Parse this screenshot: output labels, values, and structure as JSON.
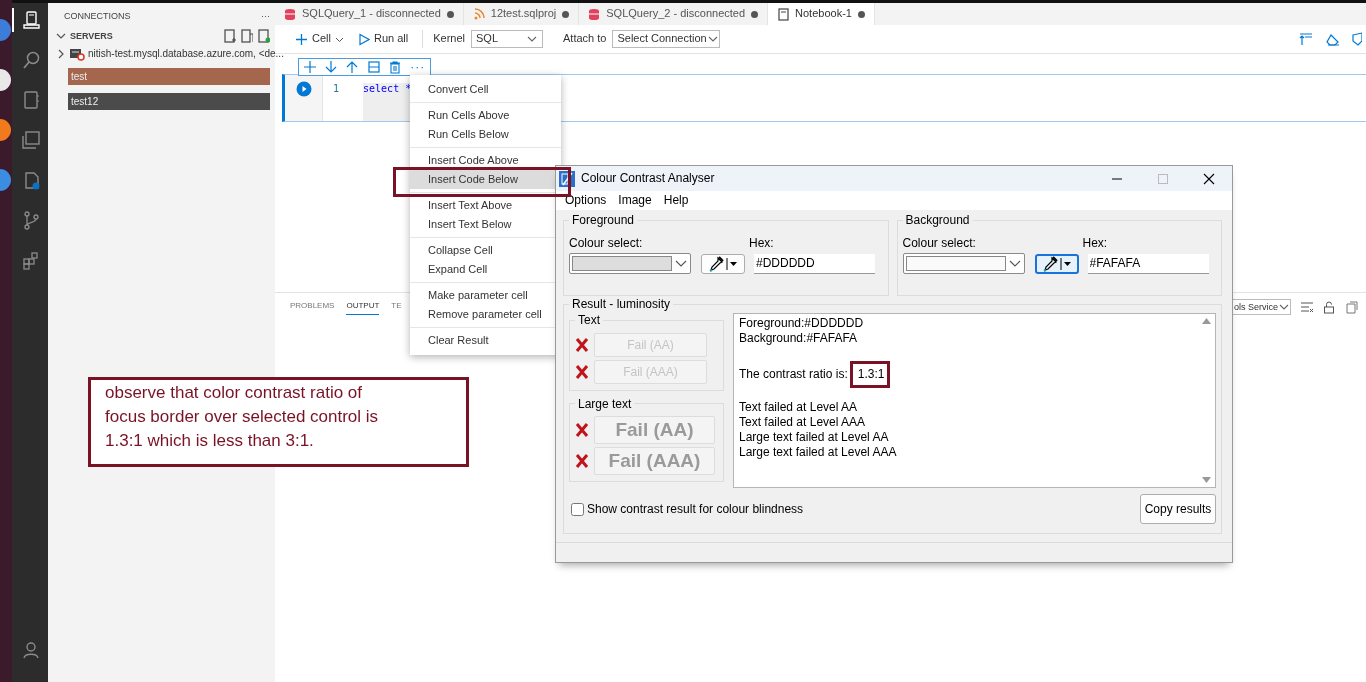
{
  "activity_bar": [
    {
      "kind": "connections",
      "selected": true
    },
    {
      "kind": "search",
      "selected": false
    },
    {
      "kind": "notebooks",
      "selected": false
    },
    {
      "kind": "windows",
      "selected": false
    },
    {
      "kind": "explorer",
      "selected": false
    },
    {
      "kind": "source-control",
      "selected": false
    },
    {
      "kind": "extensions",
      "selected": false
    },
    {
      "kind": "account",
      "selected": false
    }
  ],
  "sidebar": {
    "title": "CONNECTIONS",
    "more": "···",
    "section": "SERVERS",
    "servers": [
      {
        "name": "nitish-test.mysql.database.azure.com, <de...",
        "expanded": false,
        "children": [
          {
            "name": "test",
            "selected": true,
            "focused": false
          },
          {
            "name": "test12",
            "selected": false,
            "focused": true
          }
        ]
      }
    ]
  },
  "tabs": [
    {
      "label": "SQLQuery_1 - disconnected",
      "kind": "query",
      "selected": false
    },
    {
      "label": "12test.sqlproj",
      "kind": "project",
      "selected": false
    },
    {
      "label": "SQLQuery_2 - disconnected",
      "kind": "query",
      "selected": false
    },
    {
      "label": "Notebook-1",
      "kind": "notebook",
      "selected": true
    }
  ],
  "toolbar": {
    "cell": "Cell",
    "run_all": "Run all",
    "kernel_label": "Kernel",
    "kernel": "SQL",
    "attach_label": "Attach to",
    "attach": "Select Connection"
  },
  "cell": {
    "more": "···",
    "line_number": "1",
    "code": "select *"
  },
  "context_menu": [
    [
      {
        "label": "Convert Cell",
        "selected": false
      }
    ],
    [
      {
        "label": "Run Cells Above",
        "selected": false
      },
      {
        "label": "Run Cells Below",
        "selected": false
      }
    ],
    [
      {
        "label": "Insert Code Above",
        "selected": false
      },
      {
        "label": "Insert Code Below",
        "selected": true
      }
    ],
    [
      {
        "label": "Insert Text Above",
        "selected": false
      },
      {
        "label": "Insert Text Below",
        "selected": false
      }
    ],
    [
      {
        "label": "Collapse Cell",
        "selected": false
      },
      {
        "label": "Expand Cell",
        "selected": false
      }
    ],
    [
      {
        "label": "Make parameter cell",
        "selected": false
      },
      {
        "label": "Remove parameter cell",
        "selected": false
      }
    ],
    [
      {
        "label": "Clear Result",
        "selected": false
      }
    ]
  ],
  "panel": {
    "tabs": [
      {
        "label": "PROBLEMS",
        "selected": false
      },
      {
        "label": "OUTPUT",
        "selected": true
      },
      {
        "label": "TE",
        "selected": false
      }
    ],
    "channel": "ols Service"
  },
  "dialog": {
    "title": "Colour Contrast Analyser",
    "menu": [
      "Options",
      "Image",
      "Help"
    ],
    "pickers": [
      {
        "legend": "Foreground",
        "colour_label": "Colour select:",
        "hex_label": "Hex:",
        "hex": "#DDDDDD",
        "focused": false
      },
      {
        "legend": "Background",
        "colour_label": "Colour select:",
        "hex_label": "Hex:",
        "hex": "#FAFAFA",
        "focused": true
      }
    ],
    "result": {
      "legend": "Result - luminosity",
      "groups": [
        {
          "legend": "Text",
          "kind": "normal",
          "results": [
            {
              "label": "Fail (AA)",
              "passed": false
            },
            {
              "label": "Fail (AAA)",
              "passed": false
            }
          ]
        },
        {
          "legend": "Large text",
          "kind": "large",
          "results": [
            {
              "label": "Fail (AA)",
              "passed": false
            },
            {
              "label": "Fail (AAA)",
              "passed": false
            }
          ]
        }
      ],
      "report": [
        {
          "kind": "lines",
          "lines": [
            "Foreground:#DDDDDD",
            "Background:#FAFAFA"
          ]
        },
        {
          "kind": "ratio",
          "label": "The contrast ratio is:",
          "value": "1.3:1"
        },
        {
          "kind": "lines",
          "lines": [
            "Text failed at Level AA",
            "Text failed at Level AAA",
            "Large text failed at Level AA",
            "Large text failed at Level AAA"
          ]
        }
      ]
    },
    "checkbox": {
      "label": "Show contrast result for colour blindness",
      "checked": false
    },
    "copy_button": "Copy results"
  },
  "annotation": {
    "text": "observe that color contrast ratio of focus border over selected control is 1.3:1 which is less than 3:1."
  }
}
